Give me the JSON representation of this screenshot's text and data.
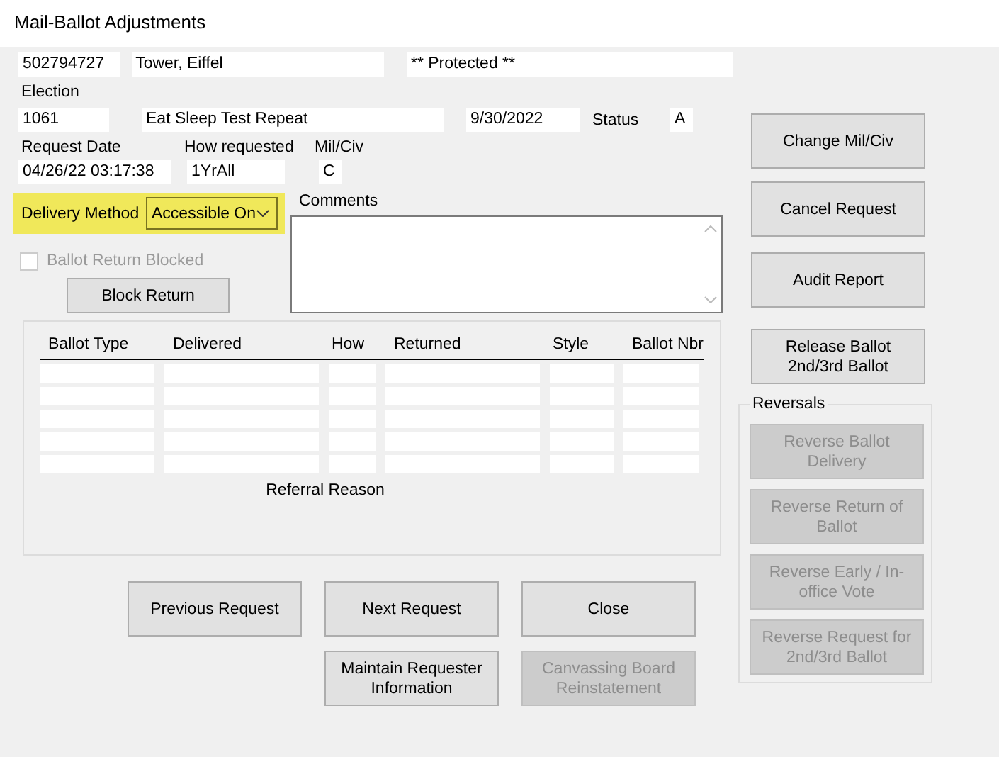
{
  "window": {
    "title": "Mail-Ballot Adjustments"
  },
  "voter": {
    "id": "502794727",
    "name": "Tower, Eiffel",
    "protected": "** Protected **"
  },
  "election": {
    "label": "Election",
    "number": "1061",
    "name": "Eat Sleep Test Repeat",
    "date": "9/30/2022",
    "status_label": "Status",
    "status": "A"
  },
  "request": {
    "date_label": "Request Date",
    "date": "04/26/22 03:17:38",
    "how_label": "How requested",
    "how": "1YrAll",
    "milciv_label": "Mil/Civ",
    "milciv": "C"
  },
  "delivery": {
    "label": "Delivery Method",
    "value": "Accessible On",
    "highlighted": true
  },
  "comments": {
    "label": "Comments"
  },
  "ballot_return_blocked": {
    "label": "Ballot Return Blocked",
    "checked": false,
    "disabled": true
  },
  "block_return": {
    "label": "Block Return",
    "disabled": false
  },
  "ballots_table": {
    "columns": [
      "Ballot Type",
      "Delivered",
      "How",
      "Returned",
      "Style",
      "Ballot Nbr"
    ]
  },
  "referral_reason_label": "Referral Reason",
  "side_buttons": [
    {
      "label": "Change Mil/Civ",
      "disabled": false
    },
    {
      "label": "Cancel Request",
      "disabled": false
    },
    {
      "label": "Audit Report",
      "disabled": false
    },
    {
      "label": "Release Ballot 2nd/3rd Ballot",
      "disabled": false
    }
  ],
  "reversals": {
    "title": "Reversals",
    "buttons": [
      {
        "label": "Reverse Ballot Delivery",
        "disabled": true
      },
      {
        "label": "Reverse Return of Ballot",
        "disabled": true
      },
      {
        "label": "Reverse Early / In-office Vote",
        "disabled": true
      },
      {
        "label": "Reverse Request for 2nd/3rd Ballot",
        "disabled": true
      }
    ]
  },
  "bottom_buttons": [
    {
      "label": "Previous Request",
      "disabled": false
    },
    {
      "label": "Next Request",
      "disabled": false
    },
    {
      "label": "Close",
      "disabled": false
    },
    {
      "label": "Maintain Requester Information",
      "disabled": false
    },
    {
      "label": "Canvassing Board Reinstatement",
      "disabled": true
    }
  ]
}
